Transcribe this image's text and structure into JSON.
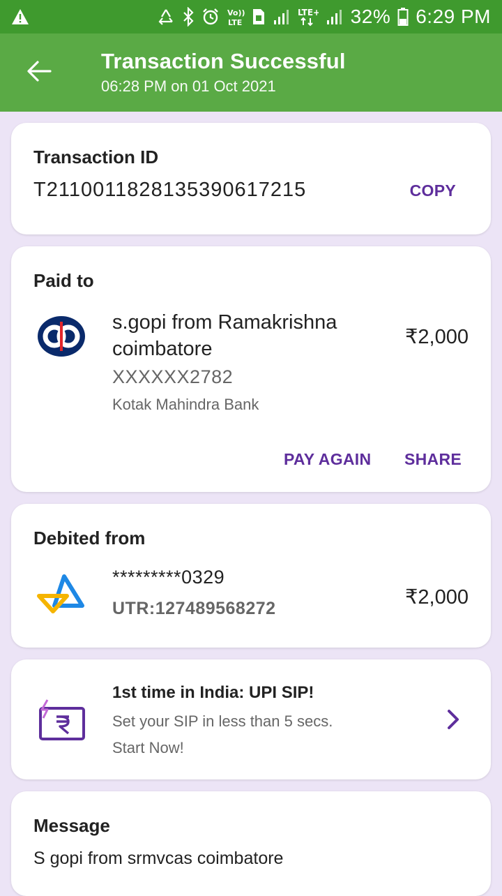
{
  "status_bar": {
    "battery": "32%",
    "time": "6:29 PM",
    "icons": [
      "warning-icon",
      "recycle-icon",
      "bluetooth-icon",
      "alarm-icon",
      "volte-icon",
      "sim-icon",
      "signal-icon",
      "lte-plus-icon",
      "signal-icon",
      "battery-icon"
    ]
  },
  "app_bar": {
    "title": "Transaction Successful",
    "subtitle": "06:28 PM on 01 Oct 2021",
    "back_icon": "back-arrow-icon"
  },
  "transaction": {
    "heading": "Transaction ID",
    "id": "T2110011828135390617215",
    "copy_label": "COPY"
  },
  "paid_to": {
    "heading": "Paid to",
    "name": "s.gopi  from Ramakrishna coimbatore",
    "account": "XXXXXX2782",
    "bank": "Kotak Mahindra Bank",
    "amount": "₹2,000",
    "pay_again_label": "PAY AGAIN",
    "share_label": "SHARE",
    "logo_icon": "kotak-bank-logo"
  },
  "debited_from": {
    "heading": "Debited from",
    "account": "*********0329",
    "utr": "UTR:127489568272",
    "amount": "₹2,000",
    "logo_icon": "sbi-bank-logo"
  },
  "promo": {
    "title": "1st time in India: UPI SIP!",
    "line1": "Set your SIP in less than 5 secs.",
    "line2": "Start Now!",
    "icon": "rupee-sip-icon"
  },
  "message": {
    "heading": "Message",
    "text": "S gopi from srmvcas coimbatore"
  },
  "colors": {
    "status_bar": "#3f9a2e",
    "app_bar": "#5aaa45",
    "accent": "#5e2e9c",
    "background": "#ece4f6"
  }
}
